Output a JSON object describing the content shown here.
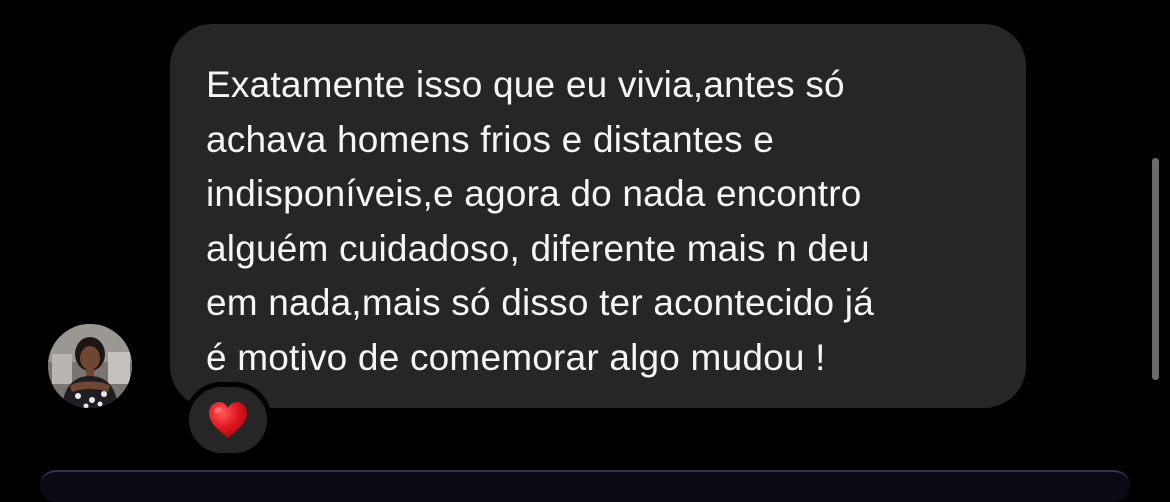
{
  "conversation": {
    "message": {
      "lines": [
        "Exatamente isso que eu vivia,antes só",
        "achava homens frios e distantes e",
        "indisponíveis,e agora do nada encontro",
        "alguém cuidadoso, diferente mais n deu",
        "em nada,mais só disso ter acontecido já",
        "é motivo de comemorar algo mudou !"
      ],
      "text": "Exatamente isso que eu vivia,antes só\nachava homens frios e distantes e\nindisponíveis,e agora do nada encontro\nalguém cuidadoso, diferente mais n deu\nem nada,mais só disso ter acontecido já\né motivo de comemorar algo mudou !",
      "reaction": {
        "emoji_icon": "red-heart-icon",
        "color": "#e0161f"
      }
    },
    "avatar_icon": "profile-photo",
    "colors": {
      "background": "#000000",
      "bubble": "#262626",
      "text": "#f5f5f5"
    }
  }
}
